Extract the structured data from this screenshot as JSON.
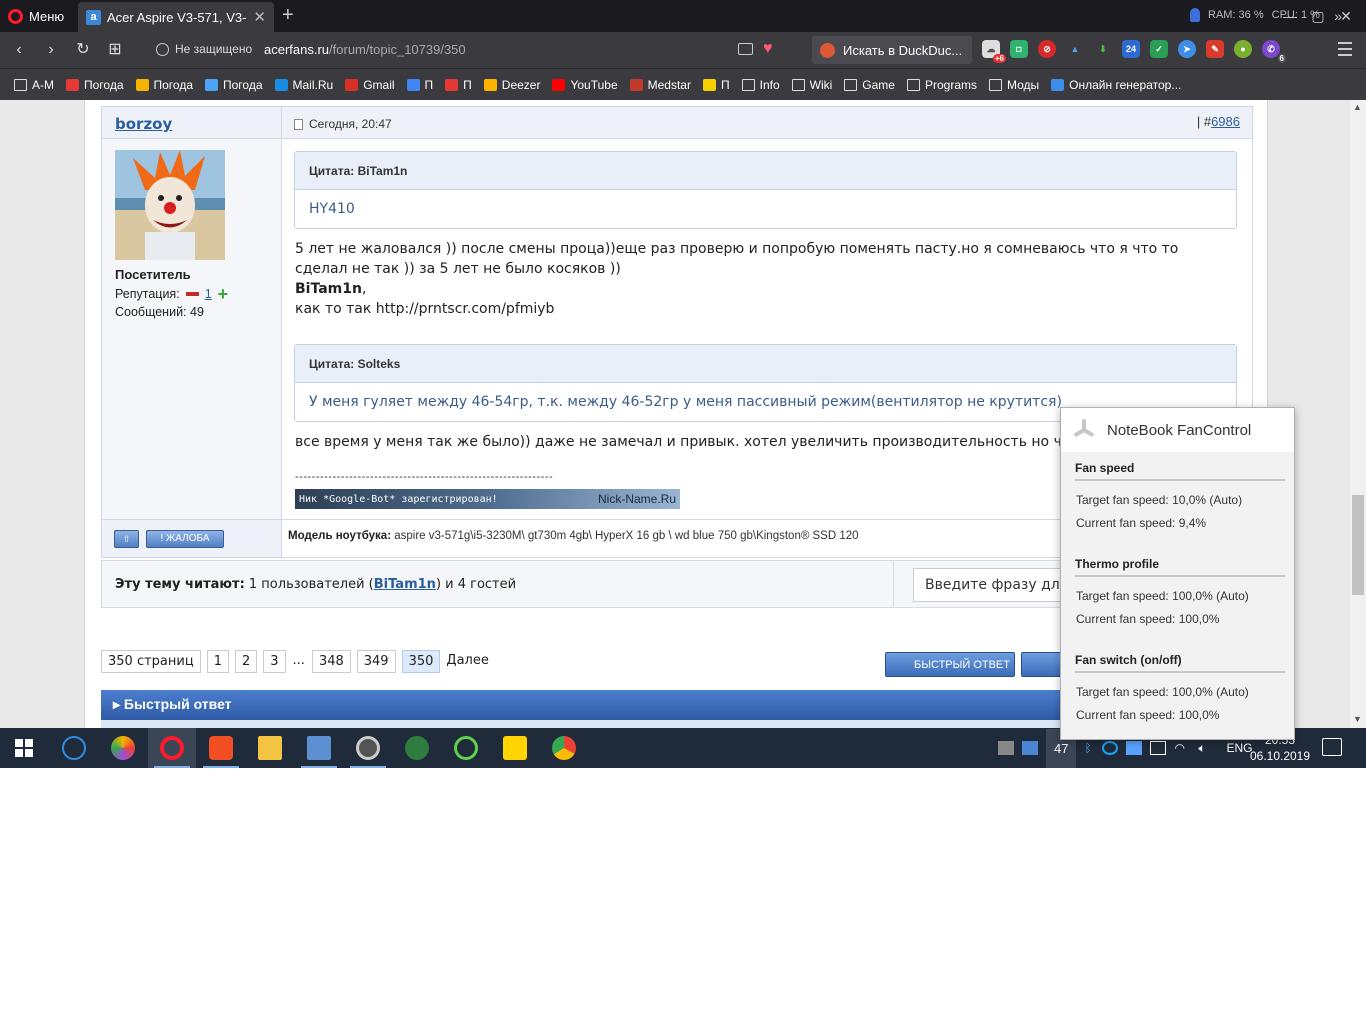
{
  "browser": {
    "menu_label": "Меню",
    "tab_title": "Acer Aspire V3-571, V3-571",
    "security_label": "Не защищено",
    "url_host": "acerfans.ru",
    "url_path": "/forum/topic_10739/350",
    "search_placeholder": "Искать в DuckDuc...",
    "ram_label": "RAM: 36 %",
    "cpu_label": "CPU: 1 %",
    "ext_badge_1": "+6",
    "ext_badge_2": "24",
    "ext_badge_3": "6"
  },
  "bookmarks": [
    {
      "label": "A-M",
      "icon": "folder-icon"
    },
    {
      "label": "Погода",
      "icon": "thermometer-icon"
    },
    {
      "label": "Погода",
      "icon": "sun-cloud-icon"
    },
    {
      "label": "Погода",
      "icon": "drop-icon"
    },
    {
      "label": "Mail.Ru",
      "icon": "at-icon"
    },
    {
      "label": "Gmail",
      "icon": "gmail-icon"
    },
    {
      "label": "П",
      "icon": "translate-icon"
    },
    {
      "label": "П",
      "icon": "dictionary-icon"
    },
    {
      "label": "Deezer",
      "icon": "deezer-icon"
    },
    {
      "label": "YouTube",
      "icon": "youtube-icon"
    },
    {
      "label": "Medstar",
      "icon": "medstar-icon"
    },
    {
      "label": "П",
      "icon": "smiley-icon"
    },
    {
      "label": "Info",
      "icon": "folder-icon"
    },
    {
      "label": "Wiki",
      "icon": "folder-icon"
    },
    {
      "label": "Game",
      "icon": "folder-icon"
    },
    {
      "label": "Programs",
      "icon": "folder-icon"
    },
    {
      "label": "Моды",
      "icon": "folder-icon"
    },
    {
      "label": "Онлайн генератор...",
      "icon": "generator-icon"
    }
  ],
  "post": {
    "author": "borzoy",
    "date": "Сегодня, 20:47",
    "num_prefix": "| #",
    "num": "6986",
    "user_title": "Посетитель",
    "reputation_label": "Репутация:",
    "reputation_value": "1",
    "messages": "Сообщений: 49",
    "quote1_head": "Цитата: BiTam1n",
    "quote1_text": "HY410",
    "para1": "5 лет не жаловался )) после смены проца))еще раз проверю и попробую поменять пасту.но я сомневаюсь что я что то сделал не так )) за 5 лет не было косяков ))",
    "para2_name": "BiTam1n",
    "para2_comma": ",",
    "para3": "как то так http://prntscr.com/pfmiyb",
    "quote2_head": "Цитата: Solteks",
    "quote2_text": "У меня гуляет между 46-54гр, т.к. между 46-52гр у меня пассивный режим(вентилятор не крутится)",
    "para4": "все время у меня так же было)) даже не замечал и привык. хотел увеличить производительность но что-то не",
    "sig_line": "--------------------------------------------------------------",
    "sig_banner_left": "Ник *Google-Bot* зарегистрирован!",
    "sig_banner_right": "Nick-Name.Ru",
    "btn_complain": "! ЖАЛОБА",
    "laptop_label": "Модель ноутбука:",
    "laptop_value": " aspire v3-571g\\i5-3230M\\ gt730m 4gb\\ HyperX 16 gb \\ wd blue 750 gb\\Kingston® SSD 120"
  },
  "readers": {
    "label": "Эту тему читают:",
    "count_text": " 1 пользователей (",
    "user": "BiTam1n",
    "tail": ") и 4 гостей",
    "search_placeholder": "Введите фразу для поиска"
  },
  "pagination": {
    "total": "350 страниц",
    "pages": [
      "1",
      "2",
      "3"
    ],
    "dots": "...",
    "tail_pages": [
      "348",
      "349"
    ],
    "current": "350",
    "next": "Далее"
  },
  "quick_reply": {
    "button": "БЫСТРЫЙ ОТВЕТ",
    "button2": "О",
    "bar_title": "Быстрый ответ"
  },
  "fan_control": {
    "title": "NoteBook FanControl",
    "sections": [
      {
        "title": "Fan speed",
        "target": "Target fan speed:  10,0% (Auto)",
        "current": "Current fan speed:  9,4%"
      },
      {
        "title": "Thermo profile",
        "target": "Target fan speed:  100,0% (Auto)",
        "current": "Current fan speed:  100,0%"
      },
      {
        "title": "Fan switch (on/off)",
        "target": "Target fan speed:  100,0% (Auto)",
        "current": "Current fan speed:  100,0%"
      }
    ]
  },
  "taskbar": {
    "tray_number": "47",
    "lang": "ENG",
    "time": "20:53",
    "date": "06.10.2019"
  }
}
